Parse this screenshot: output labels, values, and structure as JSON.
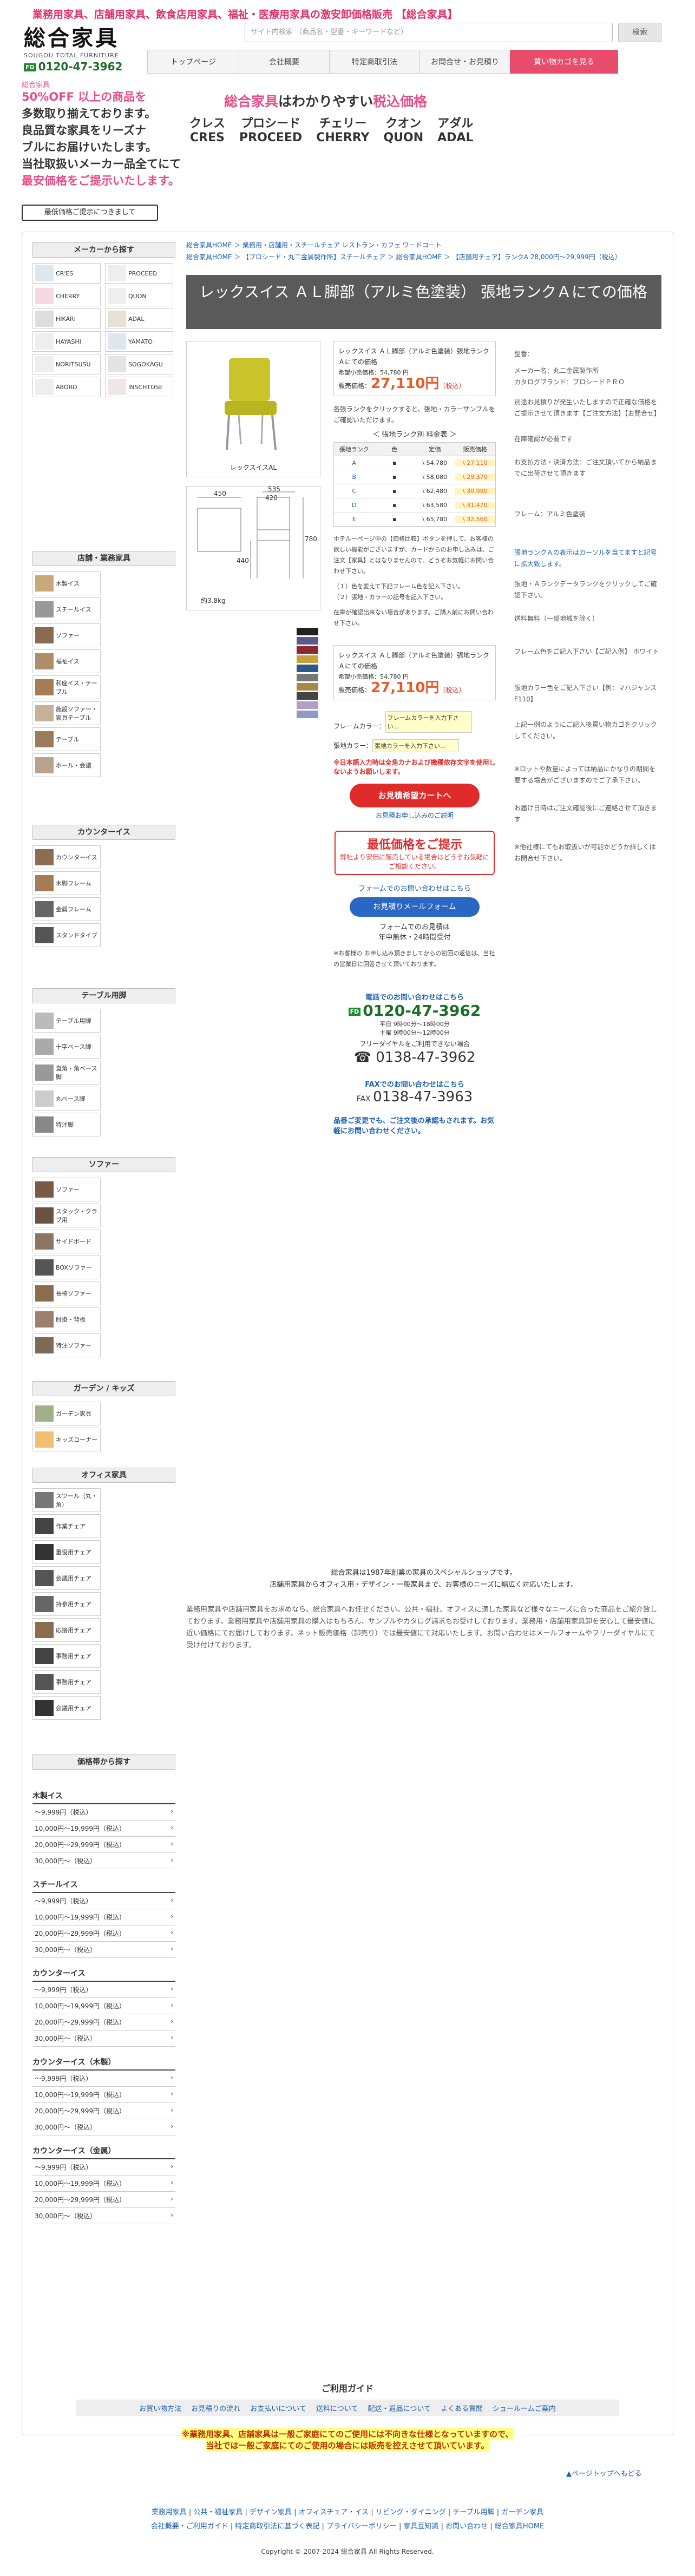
{
  "header": {
    "tagline": "業務用家具、店舗用家具、飲食店用家具、福祉・医療用家具の激安卸価格販売 【総合家具】",
    "logo_main": "総合家具",
    "logo_sub": "SOUGOU TOTAL FURNITURE",
    "logo_tel": "0120-47-3962",
    "fd_label": "FD",
    "search_placeholder": "サイト内検索 （商品名・型番・キーワードなど）",
    "search_button": "検索",
    "nav": [
      "トップページ",
      "会社概要",
      "特定商取引法",
      "お問合せ・お見積り",
      "買い物カゴを見る"
    ]
  },
  "promo": {
    "label": "総合家具",
    "line1": "50%OFF 以上の商品を",
    "line2": "多数取り揃えております。",
    "line3": "良品質な家具をリーズナ",
    "line4": "ブルにお届けいたします。",
    "line5": "当社取扱いメーカー品全てにて",
    "line6": "最安価格をご提示いたします。",
    "cheap_a": "総合家具",
    "cheap_b": "はわかりやすい",
    "cheap_c": "税込価格",
    "brands": [
      {
        "jp": "クレス",
        "en": "CRES"
      },
      {
        "jp": "プロシード",
        "en": "PROCEED"
      },
      {
        "jp": "チェリー",
        "en": "CHERRY"
      },
      {
        "jp": "クオン",
        "en": "QUON"
      },
      {
        "jp": "アダル",
        "en": "ADAL"
      }
    ],
    "maker_button": "最低価格ご提示につきまして"
  },
  "sidebar": {
    "maker_head": "メーカーから探す",
    "makers": [
      "CR'ES",
      "PROCEED",
      "CHERRY",
      "QUON",
      "HIKARI",
      "ADAL",
      "HAYASHI",
      "YAMATO",
      "NORITSUSU",
      "SOGOKAGU",
      "ABORD",
      "INSCHTOSE"
    ],
    "shop_head": "店舗・業務家具",
    "shop": [
      "木製イス",
      "スチールイス",
      "ソファー",
      "福祉イス",
      "和座イス・テーブル",
      "施設ソファー・家具テーブル",
      "テーブル",
      "ホール・会議"
    ],
    "counter_head": "カウンターイス",
    "counter": [
      "カウンターイス",
      "木脚フレーム",
      "金属フレーム",
      "スタンドタイプ"
    ],
    "table_head": "テーブル用脚",
    "table": [
      "テーブル用脚",
      "十字ベース脚",
      "直角・角ベース脚",
      "丸ベース脚",
      "特注脚"
    ],
    "sofa_head": "ソファー",
    "sofa": [
      "ソファー",
      "スタック・クラブ用",
      "サイドボード",
      "BOXソファー",
      "長椅ソファー",
      "肘掛・背板",
      "特注ソファー"
    ],
    "garden_head": "ガーデン / キッズ",
    "garden": [
      "ガーデン家具",
      "キッズコーナー"
    ],
    "office_head": "オフィス家具",
    "office": [
      "スツール（丸・角）",
      "作業チェア",
      "重役用チェア",
      "会議用チェア",
      "持参用チェア",
      "応接用チェア",
      "事務用チェア",
      "事務用チェア",
      "会議用チェア"
    ],
    "price_head": "価格帯から探す",
    "price_groups": [
      {
        "name": "木製イス",
        "rows": [
          "〜9,999円（税込）",
          "10,000円〜19,999円（税込）",
          "20,000円〜29,999円（税込）",
          "30,000円〜（税込）"
        ]
      },
      {
        "name": "スチールイス",
        "rows": [
          "〜9,999円（税込）",
          "10,000円〜19,999円（税込）",
          "20,000円〜29,999円（税込）",
          "30,000円〜（税込）"
        ]
      },
      {
        "name": "カウンターイス",
        "rows": [
          "〜9,999円（税込）",
          "10,000円〜19,999円（税込）",
          "20,000円〜29,999円（税込）",
          "30,000円〜（税込）"
        ]
      },
      {
        "name": "カウンターイス（木製）",
        "rows": [
          "〜9,999円（税込）",
          "10,000円〜19,999円（税込）",
          "20,000円〜29,999円（税込）",
          "30,000円〜（税込）"
        ]
      },
      {
        "name": "カウンターイス（金属）",
        "rows": [
          "〜9,999円（税込）",
          "10,000円〜19,999円（税込）",
          "20,000円〜29,999円（税込）",
          "30,000円〜（税込）"
        ]
      }
    ]
  },
  "breadcrumb": {
    "l1": "総合家具HOME",
    "l2": "業務用・店舗用・スチールチェア レストラン・カフェ ワードコート",
    "l3": "総合家具HOME",
    "l4": "【プロシード・丸二金属製作所】スチールチェア",
    "l5": "総合家具HOME",
    "l6": "【店舗用チェア】ランクA 28,000円〜29,999円（税込）"
  },
  "product": {
    "title": "レックスイス ＡＬ脚部（アルミ色塗装） 張地ランクＡにての価格",
    "image_caption": "レックスイスAL",
    "dims": {
      "w": "450",
      "d": "535",
      "seat_d": "420",
      "h": "780",
      "sh": "440",
      "weight": "約3.8kg"
    },
    "name": "レックスイス ＡＬ脚部（アルミ色塗装）張地ランクＡにての価格",
    "list_price_label": "希望小売価格：",
    "list_price": "54,780 円",
    "sale_label": "販売価格：",
    "sale_price": "27,110円",
    "tax": "（税込）",
    "rank_note": "各張ランクをクリックすると、張地・カラーサンプルをご確認いただけます。",
    "rank_table_title": "＜ 張地ランク別 料金表 ＞",
    "rank_headers": [
      "張地ランク",
      "色",
      "定価",
      "販売価格"
    ],
    "rank_rows": [
      {
        "rank": "A",
        "list": "\\ 54,780",
        "sale": "\\ 27,110"
      },
      {
        "rank": "B",
        "list": "\\ 58,080",
        "sale": "\\ 29,370"
      },
      {
        "rank": "C",
        "list": "\\ 62,480",
        "sale": "\\ 30,990"
      },
      {
        "rank": "D",
        "list": "\\ 63,580",
        "sale": "\\ 31,470"
      },
      {
        "rank": "E",
        "list": "\\ 65,780",
        "sale": "\\ 32,560"
      }
    ],
    "notes1": "ホテルーページ中の【価格比較】ボタンを押して、お客様の欲しい機能がございますが、カードからのお申し込みは、ご注文【家具】とはなりませんので、どうぞお気軽にお問い合わせ下さい。",
    "notes2": "（１）色を変えて下記フレーム色を記入下さい。",
    "notes3": "（２）張地・カラーの記号を記入下さい。",
    "notes4": "在庫が確認出来ない場合があります。ご購入前にお問い合わせ下さい。",
    "frame_color_label": "フレームカラー：",
    "frame_color_ph": "フレームカラーを入力下さい...",
    "fabric_color_label": "張地カラー：",
    "fabric_color_ph": "張地カラーを入力下さい...",
    "warn": "※日本語入力時は全角カナおよび機種依存文字を使用しないようお願いします。",
    "cart_button": "お見積希望カートへ",
    "cart_link": "お見積お申し込みのご説明",
    "minprice_title": "最低価格をご提示",
    "minprice_sub": "弊社より安価に販売している場合はどうぞお気軽にご相談ください。",
    "form_text": "フォームでのお問い合わせはこちら",
    "form_button": "お見積りメールフォーム",
    "form_note1": "フォームでのお見積は",
    "form_note2": "年中無休・24時間受付",
    "mail_note": "※お客様の お申し込み頂きましてからの初回の返信は、当社の営業日に回答させて頂いております。",
    "phone_head": "電話でのお問い合わせはこちら",
    "free_dial": "0120-47-3962",
    "phone_hours": "平日 9時00分〜18時00分",
    "phone_hours2": "土曜 9時00分〜12時00分",
    "free_note": "フリーダイヤルをご利用できない場合",
    "tel2": "0138-47-3962",
    "fax_head": "FAXでのお問い合わせはこちら",
    "fax": "0138-47-3963",
    "after_note": "品番ご変更でも、ご注文後の承認もされます。お気軽にお問い合わせください。",
    "company_text1": "総合家具は1987年創業の家具のスペシャルショップです。",
    "company_text2": "店舗用家具からオフィス用・デザイン・一般家具まで、お客様のニーズに幅広く対応いたします。",
    "company_text3": "業務用家具や店舗用家具をお求めなら、総合家具へお任せください。公共・福祉、オフィスに適した家具など様々なニーズに合った商品をご紹介致しております。業務用家具や店舗用家具の購入はもちろん、サンプルやカタログ請求もお受けしております。業務用・店舗用家具卸を安心して最安値に近い価格にてお届けしております。ネット販売価格（卸売り）では最安値にて対応いたします。お問い合わせはメールフォームやフリーダイヤルにて受け付けております。"
  },
  "right_info": {
    "t1": "型番：",
    "t2": "メーカー名：丸二金属製作所",
    "t3": "カタログブランド：プロシードＰＲＯ",
    "t4": "別途お見積りが発生いたしますので正確な価格をご提示させて頂きます【ご注文方法】【お問合せ】",
    "t5": "在庫確認が必要です",
    "t6": "お支払方法・決済方法：ご注文頂いてから納品までに出荷させて頂きます",
    "t7": "フレーム：アルミ色塗装",
    "t8": "張地ランクＡの表示はカーソルを当てますと記号に拡大致します。",
    "t9": "張地・Ａランクデータランクをクリックしてご確認下さい。",
    "t10": "送料無料（一部地域を除く）",
    "t11": "フレーム色をご記入下さい【ご記入例】 ホワイト",
    "t12": "張地カラー色をご記入下さい【例：マハジャンスF110】",
    "t13": "上記一例のようにご記入後買い物カゴをクリックしてください。",
    "t14": "※ロットや数量によっては納品にかなりの期間を要する場合がございますのでご了承下さい。",
    "t15": "お届け日時はご注文確認後にご連絡させて頂きます",
    "t16": "※他社様にてもお取扱いが可能かどうか詳しくはお問合せ下さい。"
  },
  "guide": {
    "title": "ご利用ガイド",
    "links": [
      "お買い物方法",
      "お見積りの流れ",
      "お支払いについて",
      "送料について",
      "配送・返品について",
      "よくある質問",
      "ショールームご案内"
    ],
    "notice1": "※業務用家具、店舗家具は一般ご家庭にてのご使用には不向きな仕様となっていますので、",
    "notice2": "当社では一般ご家庭にてのご使用の場合には販売を控えさせて頂いています。",
    "pagetop": "▲ページトップへもどる"
  },
  "footer": {
    "links1": [
      "業務用家具",
      "公共・福祉家具",
      "デザイン家具",
      "オフィスチェア・イス",
      "リビング・ダイニング",
      "テーブル用脚",
      "ガーデン家具"
    ],
    "links2": [
      "会社概要・ご利用ガイド",
      "特定商取引法に基づく表記",
      "プライバシーポリシー",
      "家具豆知識",
      "お問い合わせ",
      "総合家具HOME"
    ],
    "copyright": "Copyright © 2007-2024 総合家具 All Rights Reserved."
  }
}
